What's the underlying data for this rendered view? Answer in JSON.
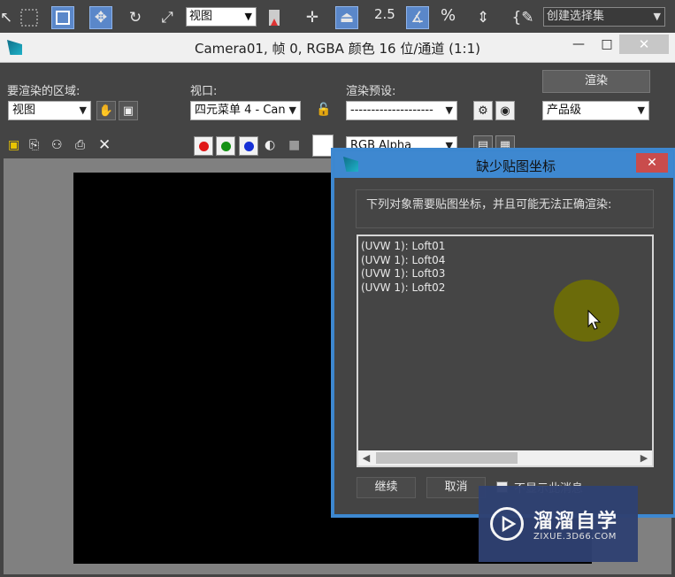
{
  "toolbar": {
    "viewport_select": "视图",
    "spinner_snap": "2.5",
    "percent_snap": "%",
    "selection_set": "创建选择集"
  },
  "render_window": {
    "title": "Camera01, 帧 0, RGBA 颜色 16 位/通道 (1:1)",
    "area_label": "要渲染的区域:",
    "area_value": "视图",
    "viewport_label": "视口:",
    "viewport_value": "四元菜单 4 - Can",
    "preset_label": "渲染预设:",
    "preset_value": "--------------------",
    "render_button": "渲染",
    "quality_value": "产品级",
    "channel_value": "RGB Alpha",
    "minimize": "—",
    "maximize": "□",
    "close": "✕"
  },
  "dialog": {
    "title": "缺少贴图坐标",
    "close": "✕",
    "message": "下列对象需要贴图坐标，并且可能无法正确渲染:",
    "items": [
      "(UVW 1): Loft01",
      "(UVW 1): Loft04",
      "(UVW 1): Loft03",
      "(UVW 1): Loft02"
    ],
    "continue_button": "继续",
    "cancel_button": "取消",
    "dont_show_label": "不显示此消息"
  },
  "watermark": {
    "name": "溜溜自学",
    "url": "ZIXUE.3D66.COM"
  },
  "colors": {
    "dialog_title": "#3e88d0",
    "close_red": "#c94c4c",
    "watermark_bg": "#2f4172"
  }
}
